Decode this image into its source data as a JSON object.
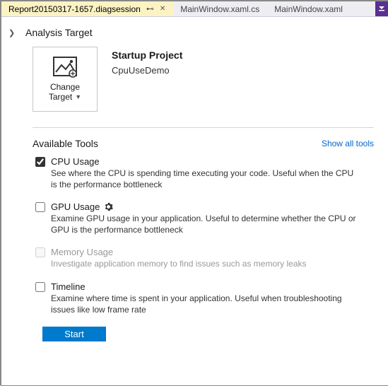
{
  "tabs": {
    "active_label": "Report20150317-1657.diagsession",
    "tab1_label": "MainWindow.xaml.cs",
    "tab2_label": "MainWindow.xaml"
  },
  "analysis": {
    "section_title": "Analysis Target",
    "change_target_line1": "Change",
    "change_target_line2": "Target",
    "startup_title": "Startup Project",
    "startup_project": "CpuUseDemo"
  },
  "tools_section": {
    "title": "Available Tools",
    "show_all": "Show all tools"
  },
  "tools": {
    "cpu": {
      "name": "CPU Usage",
      "desc": "See where the CPU is spending time executing your code. Useful when the CPU is the performance bottleneck"
    },
    "gpu": {
      "name": "GPU Usage",
      "desc": "Examine GPU usage in your application. Useful to determine whether the CPU or GPU is the performance bottleneck"
    },
    "memory": {
      "name": "Memory Usage",
      "desc": "Investigate application memory to find issues such as memory leaks"
    },
    "timeline": {
      "name": "Timeline",
      "desc": "Examine where time is spent in your application. Useful when troubleshooting issues like low frame rate"
    }
  },
  "start_label": "Start"
}
